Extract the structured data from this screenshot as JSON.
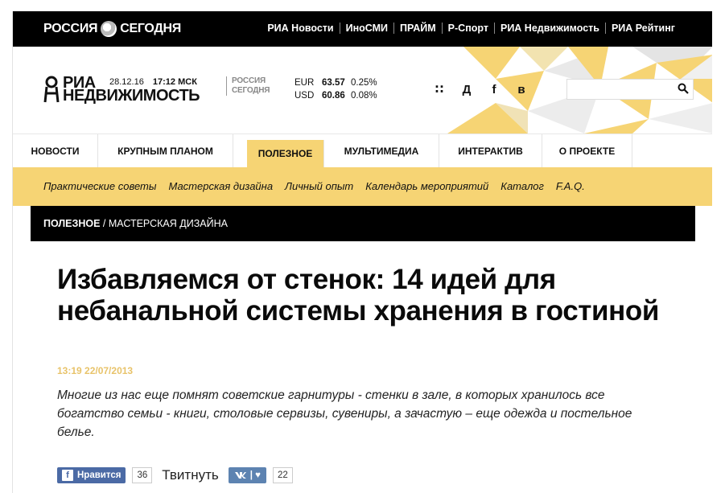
{
  "topbar": {
    "brand_left": "РОССИЯ",
    "brand_right": "СЕГОДНЯ",
    "links": [
      "РИА Новости",
      "ИноСМИ",
      "ПРАЙМ",
      "Р-Спорт",
      "РИА Недвижимость",
      "РИА Рейтинг"
    ]
  },
  "header": {
    "logo_line1": "РИА",
    "logo_line2": "НЕДВИЖИМОСТЬ",
    "date": "28.12.16",
    "time": "17:12 МСК",
    "rossiya_line1": "РОССИЯ",
    "rossiya_line2": "СЕГОДНЯ",
    "rates": [
      {
        "currency": "EUR",
        "value": "63.57",
        "change": "0.25%"
      },
      {
        "currency": "USD",
        "value": "60.86",
        "change": "0.08%"
      }
    ],
    "social_icons": [
      "rss-icon",
      "odnoklassniki-icon",
      "facebook-icon",
      "vk-icon"
    ],
    "social_glyphs": [
      "∷",
      "Д",
      "f",
      "в"
    ],
    "search_placeholder": ""
  },
  "mainnav": {
    "items": [
      {
        "label": "НОВОСТИ",
        "active": false
      },
      {
        "label": "КРУПНЫМ ПЛАНОМ",
        "active": false
      },
      {
        "label": "ПОЛЕЗНОЕ",
        "active": true
      },
      {
        "label": "МУЛЬТИМЕДИА",
        "active": false
      },
      {
        "label": "ИНТЕРАКТИВ",
        "active": false
      },
      {
        "label": "О ПРОЕКТЕ",
        "active": false
      }
    ]
  },
  "subnav": {
    "links": [
      "Практические советы",
      "Мастерская дизайна",
      "Личный опыт",
      "Календарь мероприятий",
      "Каталог",
      "F.A.Q."
    ]
  },
  "breadcrumb": {
    "section": "ПОЛЕЗНОЕ",
    "separator": " / ",
    "subsection": "МАСТЕРСКАЯ ДИЗАЙНА"
  },
  "article": {
    "title": "Избавляемся от стенок: 14 идей для небанальной системы хранения в гостиной",
    "datetime": "13:19 22/07/2013",
    "lead": "Многие из нас еще помнят советские гарнитуры - стенки в зале, в которых хранилось все богатство семьи - книги, столовые сервизы, сувениры, а зачастую – еще одежда и постельное белье."
  },
  "share": {
    "fb_label": "Нравится",
    "fb_count": "36",
    "twitter_label": "Твитнуть",
    "vk_label": "| ♥",
    "vk_count": "22"
  },
  "colors": {
    "accent_yellow": "#f6d474",
    "black": "#000000",
    "date_color": "#e8c36a",
    "facebook": "#4b6aa5",
    "vk": "#5d83b1"
  }
}
